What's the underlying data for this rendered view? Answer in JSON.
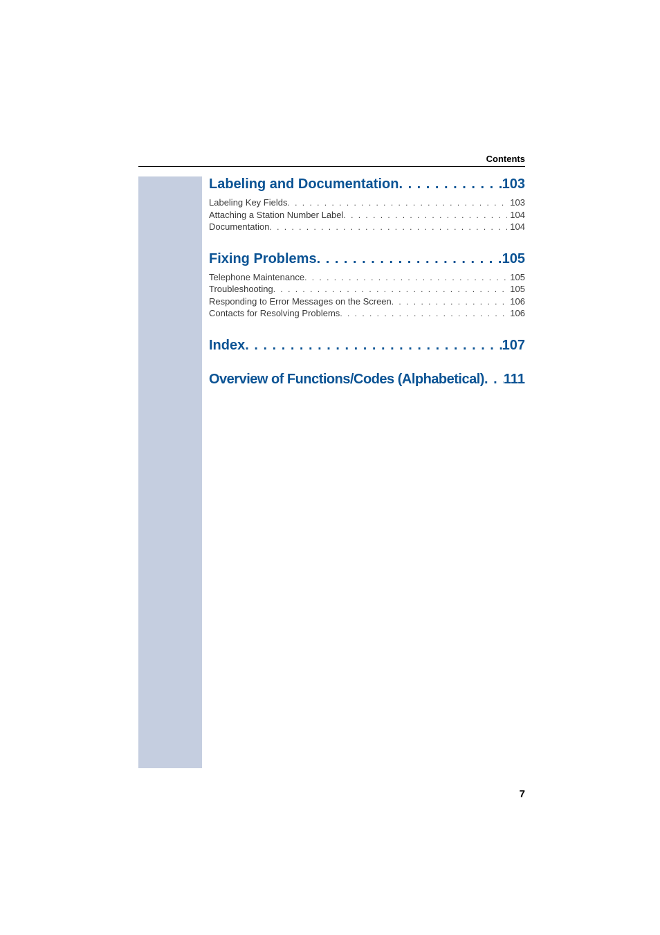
{
  "header": {
    "label": "Contents"
  },
  "sections": [
    {
      "title": "Labeling and Documentation",
      "page": "103",
      "entries": [
        {
          "title": "Labeling Key Fields",
          "page": "103"
        },
        {
          "title": "Attaching a Station Number Label",
          "page": "104"
        },
        {
          "title": "Documentation",
          "page": "104"
        }
      ]
    },
    {
      "title": "Fixing Problems",
      "page": "105",
      "entries": [
        {
          "title": "Telephone Maintenance",
          "page": "105"
        },
        {
          "title": "Troubleshooting",
          "page": "105"
        },
        {
          "title": "Responding to Error Messages on the Screen",
          "page": "106"
        },
        {
          "title": "Contacts for Resolving Problems",
          "page": "106"
        }
      ]
    },
    {
      "title": "Index",
      "page": "107",
      "entries": []
    },
    {
      "title": "Overview of Functions/Codes (Alphabetical)",
      "page": "111",
      "entries": []
    }
  ],
  "dots": {
    "heading": " . . . . . . . . . . . . . . . . . . . . . . . . . . . . . . . . . . . .",
    "entry": " . . . . . . . . . . . . . . . . . . . . . . . . . . . . . . . . . . . . . . . . . . . . . . . . . . . . . . . . . . . . "
  },
  "pageNumber": "7"
}
